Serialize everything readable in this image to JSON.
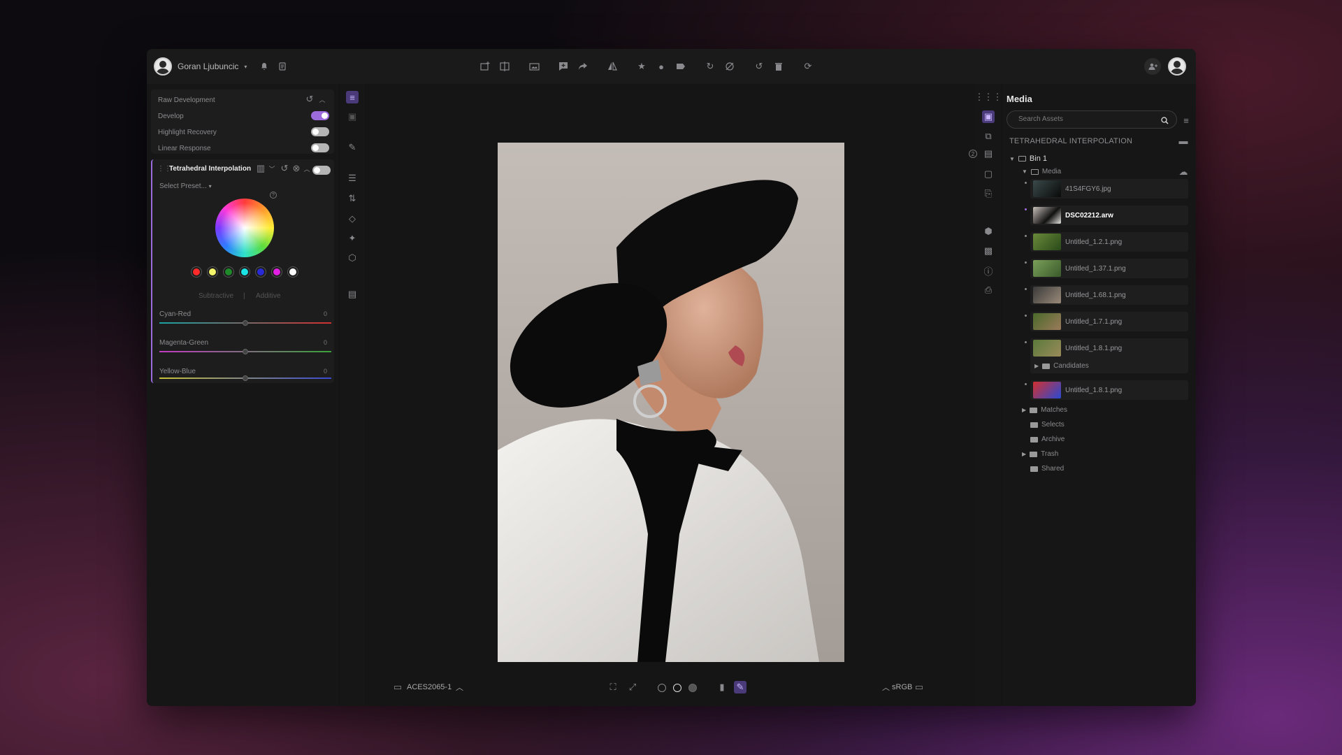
{
  "topbar": {
    "username": "Goran Ljubuncic",
    "icons": [
      "bell-icon",
      "document-icon",
      "image-add-icon",
      "compare-icon",
      "gallery-icon",
      "comment-add-icon",
      "share-icon",
      "mirror-icon",
      "star-icon",
      "circle-icon",
      "tag-icon",
      "rotate-icon",
      "hide-icon",
      "undo-icon",
      "trash-icon",
      "sync-icon",
      "add-user-icon"
    ]
  },
  "left_panel": {
    "raw_section": {
      "title": "Raw Development",
      "rows": [
        {
          "label": "Develop",
          "on": true
        },
        {
          "label": "Highlight Recovery",
          "on": false
        },
        {
          "label": "Linear Response",
          "on": false
        }
      ]
    },
    "tetra_section": {
      "title": "Tetrahedral Interpolation",
      "preset_label": "Select Preset...",
      "help": "?",
      "swatch_colors": [
        "#ff2a2a",
        "#f4f46b",
        "#1f8a2a",
        "#1ce4e4",
        "#2a2ad8",
        "#e21fe2",
        "#ffffff"
      ],
      "mode_left": "Subtractive",
      "mode_divider": "|",
      "mode_right": "Additive",
      "sliders": [
        {
          "label": "Cyan-Red",
          "value": "0",
          "gradient": [
            "#1aa3a3",
            "#d23030"
          ]
        },
        {
          "label": "Magenta-Green",
          "value": "0",
          "gradient": [
            "#c23ac2",
            "#3aa23a"
          ]
        },
        {
          "label": "Yellow-Blue",
          "value": "0",
          "gradient": [
            "#c8c23a",
            "#3a4ad2"
          ]
        }
      ]
    }
  },
  "viewer": {
    "color_space_in": "ACES2065-1",
    "color_space_out": "sRGB"
  },
  "media_panel": {
    "title": "Media",
    "search_placeholder": "Search Assets",
    "project_name": "TETRAHEDRAL INTERPOLATION",
    "bin": "Bin 1",
    "media_folder": "Media",
    "assets": [
      {
        "name": "41S4FGY6.jpg",
        "selected": false
      },
      {
        "name": "DSC02212.arw",
        "selected": true
      },
      {
        "name": "Untitled_1.2.1.png",
        "selected": false
      },
      {
        "name": "Untitled_1.37.1.png",
        "selected": false
      },
      {
        "name": "Untitled_1.68.1.png",
        "selected": false
      },
      {
        "name": "Untitled_1.7.1.png",
        "selected": false
      },
      {
        "name": "Untitled_1.8.1.png",
        "selected": false
      },
      {
        "name": "Untitled_1.8.1.png",
        "selected": false
      }
    ],
    "subfolder": "Candidates",
    "folders": [
      "Matches",
      "Selects",
      "Archive",
      "Trash",
      "Shared"
    ],
    "badge_count": "2"
  },
  "colors": {
    "accent": "#9d6bdc",
    "panel": "#161616",
    "card": "#1d1d1d"
  }
}
